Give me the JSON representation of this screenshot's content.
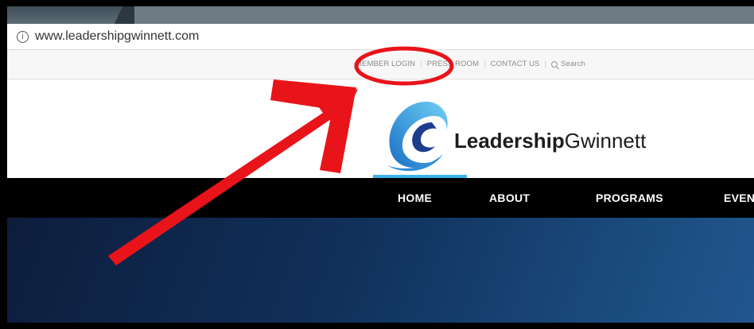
{
  "browser": {
    "url": "www.leadershipgwinnett.com",
    "info_icon": "i"
  },
  "utility_nav": {
    "member_login": "MEMBER LOGIN",
    "press_room": "PRESS ROOM",
    "contact_us": "CONTACT US",
    "search": "Search",
    "separator": "|"
  },
  "brand": {
    "name_bold": "Leadership",
    "name_regular": "Gwinnett",
    "logo_icon": "swirl-logo-icon"
  },
  "main_nav": {
    "items": [
      "HOME",
      "ABOUT",
      "PROGRAMS",
      "EVEN"
    ],
    "active": "HOME"
  },
  "annotation": {
    "highlight_color": "#e8141a",
    "marker": "circle-and-arrow"
  },
  "colors": {
    "nav_bg": "#000000",
    "accent": "#3db3e8",
    "hero_dark": "#0d1d3c",
    "hero_light": "#21578e"
  }
}
